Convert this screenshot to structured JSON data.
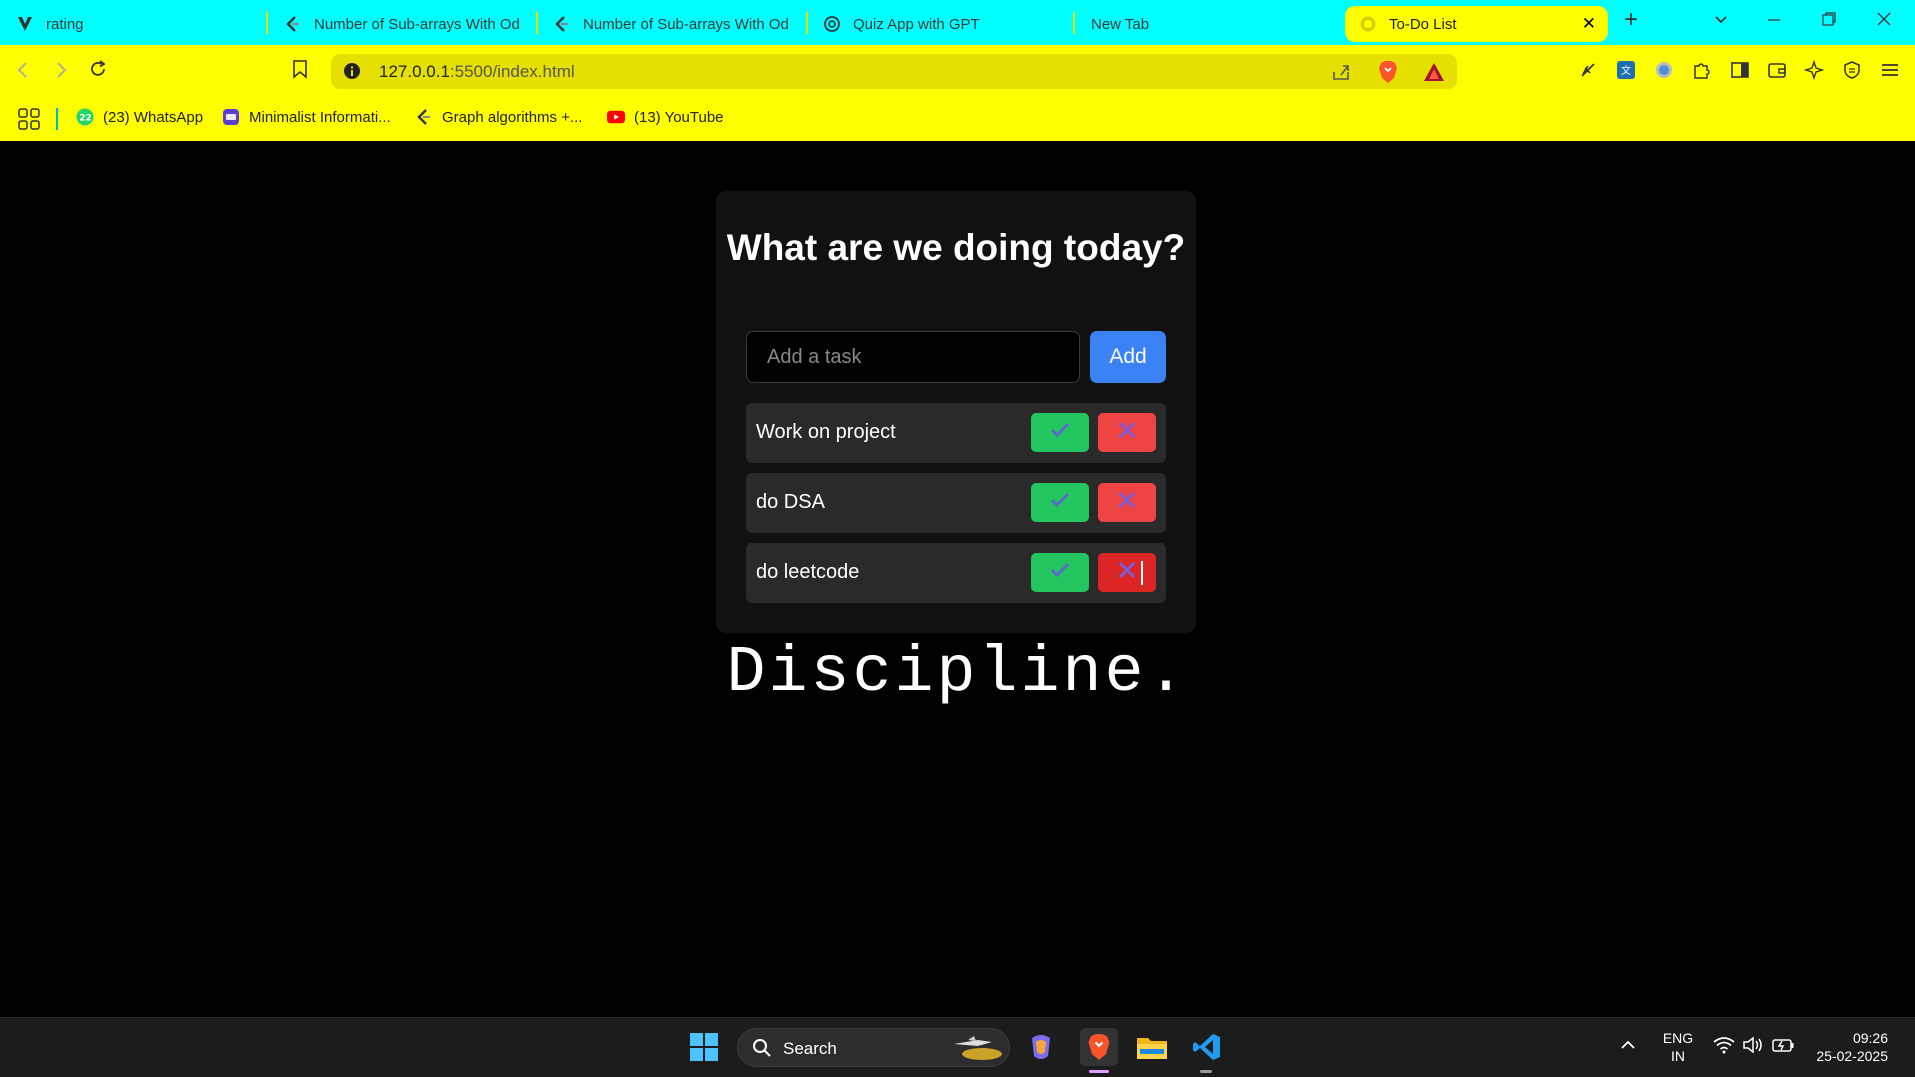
{
  "browser": {
    "tabs": [
      {
        "label": "rating",
        "icon": "v-logo-icon"
      },
      {
        "label": "Number of Sub-arrays With Od",
        "icon": "leetcode-icon"
      },
      {
        "label": "Number of Sub-arrays With Od",
        "icon": "leetcode-icon"
      },
      {
        "label": "Quiz App with GPT",
        "icon": "openai-icon"
      },
      {
        "label": "New Tab",
        "icon": ""
      },
      {
        "label": "To-Do List",
        "icon": "globe-icon",
        "active": true
      }
    ],
    "address": {
      "host": "127.0.0.1",
      "rest": ":5500/index.html"
    },
    "bookmarks": [
      {
        "label": "(23) WhatsApp",
        "badge": "22"
      },
      {
        "label": "Minimalist Informati..."
      },
      {
        "label": "Graph algorithms +..."
      },
      {
        "label": "(13) YouTube"
      }
    ],
    "colors": {
      "tabstrip": "#00ffff",
      "toolbar": "#ffff00"
    }
  },
  "page": {
    "title": "What are we doing today?",
    "input_placeholder": "Add a task",
    "add_label": "Add",
    "tasks": [
      {
        "label": "Work on project"
      },
      {
        "label": "do DSA"
      },
      {
        "label": "do leetcode"
      }
    ],
    "motto": "Discipline.",
    "colors": {
      "add": "#3b82f6",
      "done": "#22c55e",
      "delete": "#ef4444"
    }
  },
  "taskbar": {
    "search_label": "Search",
    "language": {
      "line1": "ENG",
      "line2": "IN"
    },
    "time": "09:26",
    "date": "25-02-2025"
  }
}
